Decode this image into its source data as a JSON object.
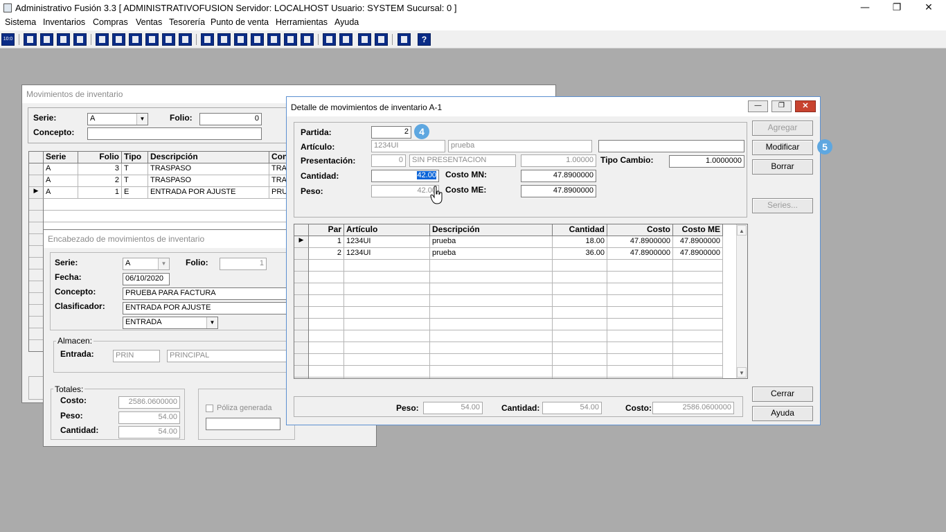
{
  "app": {
    "title": "Administrativo Fusión 3.3 [ ADMINISTRATIVOFUSION   Servidor: LOCALHOST   Usuario: SYSTEM     Sucursal: 0 ]",
    "minimize": "—",
    "restore": "❐",
    "close": "✕"
  },
  "menu": [
    "Sistema",
    "Inventarios",
    "Compras",
    "Ventas",
    "Tesorería",
    "Punto de venta",
    "Herramientas",
    "Ayuda"
  ],
  "toolbar": {
    "first_label": "10:0",
    "help_label": "?"
  },
  "mov": {
    "title": "Movimientos de inventario",
    "serie_label": "Serie:",
    "serie_value": "A",
    "folio_label": "Folio:",
    "folio_value": "0",
    "concepto_label": "Concepto:",
    "columns": [
      "Serie",
      "Folio",
      "Tipo",
      "Descripción",
      "Con"
    ],
    "rows": [
      {
        "serie": "A",
        "folio": "3",
        "tipo": "T",
        "desc": "TRASPASO",
        "con": "TRAS"
      },
      {
        "serie": "A",
        "folio": "2",
        "tipo": "T",
        "desc": "TRASPASO",
        "con": "TRAS"
      },
      {
        "serie": "A",
        "folio": "1",
        "tipo": "E",
        "desc": "ENTRADA POR AJUSTE",
        "con": "PRU"
      }
    ],
    "row_marker": "▶"
  },
  "enc": {
    "title": "Encabezado de movimientos de inventario",
    "serie_label": "Serie:",
    "serie_value": "A",
    "folio_label": "Folio:",
    "folio_value": "1",
    "fecha_label": "Fecha:",
    "fecha_value": "06/10/2020",
    "concepto_label": "Concepto:",
    "concepto_value": "PRUEBA PARA FACTURA",
    "clasificador_label": "Clasificador:",
    "clasificador_value": "ENTRADA POR AJUSTE",
    "tipo_value": "ENTRADA",
    "almacen_label": "Almacen:",
    "entrada_label": "Entrada:",
    "entrada_code": "PRIN",
    "entrada_name": "PRINCIPAL",
    "totales_label": "Totales:",
    "costo_label": "Costo:",
    "costo_value": "2586.0600000",
    "peso_label": "Peso:",
    "peso_value": "54.00",
    "cantidad_label": "Cantidad:",
    "cantidad_value": "54.00",
    "poliza_label": "Póliza generada"
  },
  "det": {
    "title": "Detalle de movimientos de inventario A-1",
    "partida_label": "Partida:",
    "partida_value": "2",
    "articulo_label": "Artículo:",
    "articulo_code": "1234UI",
    "articulo_name": "prueba",
    "presentacion_label": "Presentación:",
    "presentacion_num": "0",
    "presentacion_name": "SIN PRESENTACION",
    "presentacion_factor": "1.00000",
    "tipo_cambio_label": "Tipo Cambio:",
    "tipo_cambio_value": "1.0000000",
    "cantidad_label": "Cantidad:",
    "cantidad_value": "42.00",
    "costo_mn_label": "Costo MN:",
    "costo_mn_value": "47.8900000",
    "peso_label": "Peso:",
    "peso_value": "42.00",
    "costo_me_label": "Costo ME:",
    "costo_me_value": "47.8900000",
    "buttons": {
      "agregar": "Agregar",
      "modificar": "Modificar",
      "borrar": "Borrar",
      "series": "Series...",
      "cerrar": "Cerrar",
      "ayuda": "Ayuda"
    },
    "columns": [
      "Par",
      "Artículo",
      "Descripción",
      "Cantidad",
      "Costo",
      "Costo ME"
    ],
    "rows": [
      {
        "par": "1",
        "articulo": "1234UI",
        "desc": "prueba",
        "cantidad": "18.00",
        "costo": "47.8900000",
        "costo_me": "47.8900000"
      },
      {
        "par": "2",
        "articulo": "1234UI",
        "desc": "prueba",
        "cantidad": "36.00",
        "costo": "47.8900000",
        "costo_me": "47.8900000"
      }
    ],
    "row_marker": "▶",
    "foot_peso_label": "Peso:",
    "foot_peso_value": "54.00",
    "foot_cantidad_label": "Cantidad:",
    "foot_cantidad_value": "54.00",
    "foot_costo_label": "Costo:",
    "foot_costo_value": "2586.0600000"
  },
  "badges": {
    "step4": "4",
    "step5": "5"
  }
}
